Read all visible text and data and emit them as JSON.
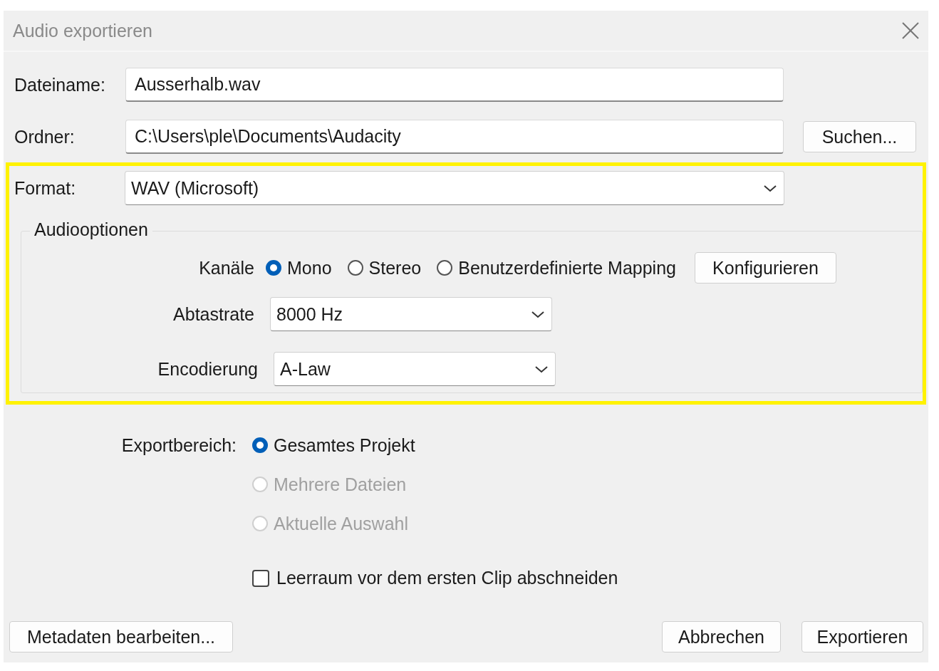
{
  "window": {
    "title": "Audio exportieren"
  },
  "file_name": {
    "label": "Dateiname:",
    "value": "Ausserhalb.wav"
  },
  "folder": {
    "label": "Ordner:",
    "value": "C:\\Users\\ple\\Documents\\Audacity",
    "browse_button": "Suchen..."
  },
  "format": {
    "label": "Format:",
    "value": "WAV (Microsoft)"
  },
  "audio_options": {
    "title": "Audiooptionen",
    "channels": {
      "label": "Kanäle",
      "options": [
        {
          "label": "Mono",
          "selected": true
        },
        {
          "label": "Stereo",
          "selected": false
        },
        {
          "label": "Benutzerdefinierte Mapping",
          "selected": false
        }
      ],
      "configure_button": "Konfigurieren"
    },
    "sample_rate": {
      "label": "Abtastrate",
      "value": "8000 Hz"
    },
    "encoding": {
      "label": "Encodierung",
      "value": "A-Law"
    }
  },
  "export_range": {
    "label": "Exportbereich:",
    "options": [
      {
        "label": "Gesamtes Projekt",
        "selected": true,
        "disabled": false
      },
      {
        "label": "Mehrere Dateien",
        "selected": false,
        "disabled": true
      },
      {
        "label": "Aktuelle Auswahl",
        "selected": false,
        "disabled": true
      }
    ]
  },
  "trim_silence": {
    "label": "Leerraum vor dem ersten Clip abschneiden",
    "checked": false
  },
  "buttons": {
    "metadata": "Metadaten bearbeiten...",
    "cancel": "Abbrechen",
    "export": "Exportieren"
  }
}
